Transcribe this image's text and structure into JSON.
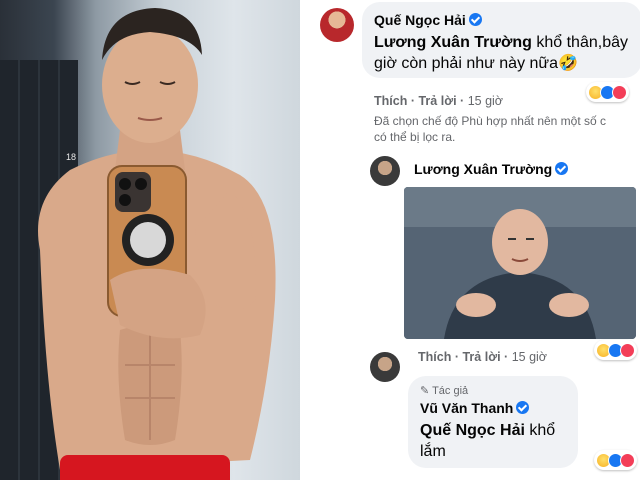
{
  "photo": {
    "locker_number": "18"
  },
  "comments": [
    {
      "author": "Quế Ngọc Hải",
      "verified": true,
      "text_mention": "Lương Xuân Trường",
      "text_line1_rest": " khổ thân,bây",
      "text_line2": "giờ còn phải như này nữa🤣",
      "actions": {
        "like": "Thích",
        "reply": "Trả lời",
        "time": "15 giờ"
      },
      "reactions": [
        "haha",
        "like",
        "love"
      ]
    },
    {
      "author": "Lương Xuân Trường",
      "verified": true,
      "has_image": true,
      "actions": {
        "like": "Thích",
        "reply": "Trả lời",
        "time": "15 giờ"
      },
      "reactions": [
        "haha",
        "like",
        "love"
      ]
    },
    {
      "author_tag": "Tác giả",
      "author": "Vũ Văn Thanh",
      "verified": true,
      "text_mention": "Quế Ngọc Hải",
      "text_line1_rest": " khổ",
      "text_line2": "lắm",
      "reactions": [
        "haha",
        "like",
        "love"
      ]
    }
  ],
  "filter_note": {
    "line1": "Đã chọn chế độ Phù hợp nhất nên một số c",
    "line2": "có thể bị lọc ra."
  },
  "separators": {
    "dot": "·"
  },
  "colors": {
    "name": "#050505",
    "meta": "#65676b",
    "bubble": "#f0f2f5",
    "verified": "#1877f2"
  }
}
